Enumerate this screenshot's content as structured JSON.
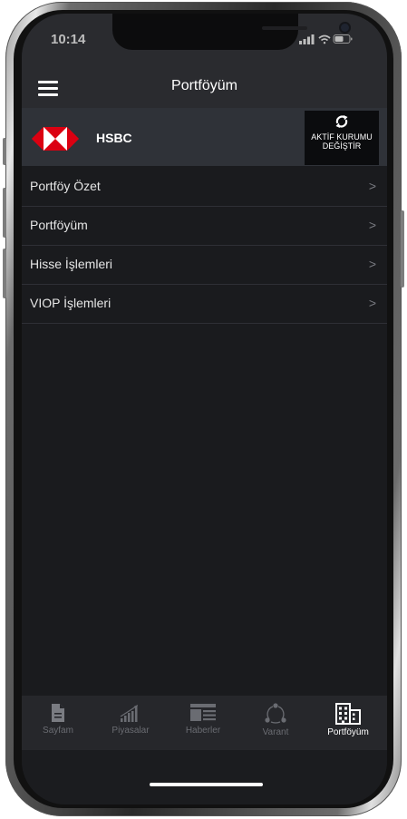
{
  "status": {
    "time": "10:14"
  },
  "header": {
    "title": "Portföyüm"
  },
  "institution": {
    "name": "HSBC",
    "switch_label": "AKTİF KURUMU\nDEĞİŞTİR"
  },
  "menu": {
    "items": [
      {
        "label": "Portföy Özet",
        "chevron": ">"
      },
      {
        "label": "Portföyüm",
        "chevron": ">"
      },
      {
        "label": "Hisse İşlemleri",
        "chevron": ">"
      },
      {
        "label": "VIOP İşlemleri",
        "chevron": ">"
      }
    ]
  },
  "tabs": [
    {
      "label": "Sayfam",
      "icon": "document-icon",
      "active": false
    },
    {
      "label": "Piyasalar",
      "icon": "bar-chart-icon",
      "active": false
    },
    {
      "label": "Haberler",
      "icon": "news-icon",
      "active": false
    },
    {
      "label": "Varant",
      "icon": "cycle-icon",
      "active": false
    },
    {
      "label": "Portföyüm",
      "icon": "buildings-icon",
      "active": true
    }
  ],
  "colors": {
    "brand_red": "#db0011",
    "active_tab": "#ffffff",
    "inactive_tab": "#6a6c72"
  }
}
